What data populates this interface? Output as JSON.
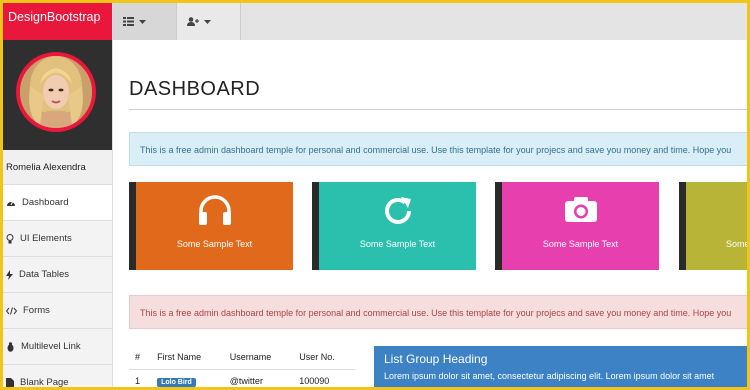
{
  "brand": "DesignBootstrap",
  "user": {
    "name": "Romelia Alexendra"
  },
  "sidebar": {
    "items": [
      {
        "label": "Dashboard",
        "icon": "dashboard-icon"
      },
      {
        "label": "UI Elements",
        "icon": "bulb-icon"
      },
      {
        "label": "Data Tables",
        "icon": "bolt-icon"
      },
      {
        "label": "Forms",
        "icon": "code-icon"
      },
      {
        "label": "Multilevel Link",
        "icon": "bug-icon"
      },
      {
        "label": "Blank Page",
        "icon": "file-icon"
      }
    ]
  },
  "topbar": {
    "menu_icon": "list-icon",
    "user_icon": "user-plus-icon"
  },
  "main": {
    "title": "DASHBOARD",
    "info_alert": "This is a free admin dashboard temple for personal and commercial use. Use this template for your projecs and save you money and time. Hope you",
    "danger_alert": "This is a free admin dashboard temple for personal and commercial use. Use this template for your projecs and save you money and time. Hope you",
    "tiles": [
      {
        "label": "Some Sample Text",
        "icon": "headphones-icon",
        "color": "#e1691b"
      },
      {
        "label": "Some Sample Text",
        "icon": "refresh-icon",
        "color": "#2bbfae"
      },
      {
        "label": "Some Sample Text",
        "icon": "camera-icon",
        "color": "#e83fae"
      },
      {
        "label": "Some",
        "icon": "",
        "color": "#b8b438"
      }
    ],
    "table": {
      "headers": [
        "#",
        "First Name",
        "Username",
        "User No."
      ],
      "rows": [
        [
          "1",
          "Lolo Bird",
          "@twitter",
          "100090"
        ]
      ]
    },
    "list_group": {
      "heading": "List Group Heading",
      "text": "Lorem ipsum dolor sit amet, consectetur adipiscing elit. Lorem ipsum dolor sit amet"
    }
  },
  "colors": {
    "accent": "#e8173b",
    "sidebar_dark": "#2f2f2f",
    "frame": "#f0c419",
    "list_blue": "#3c82c4"
  }
}
